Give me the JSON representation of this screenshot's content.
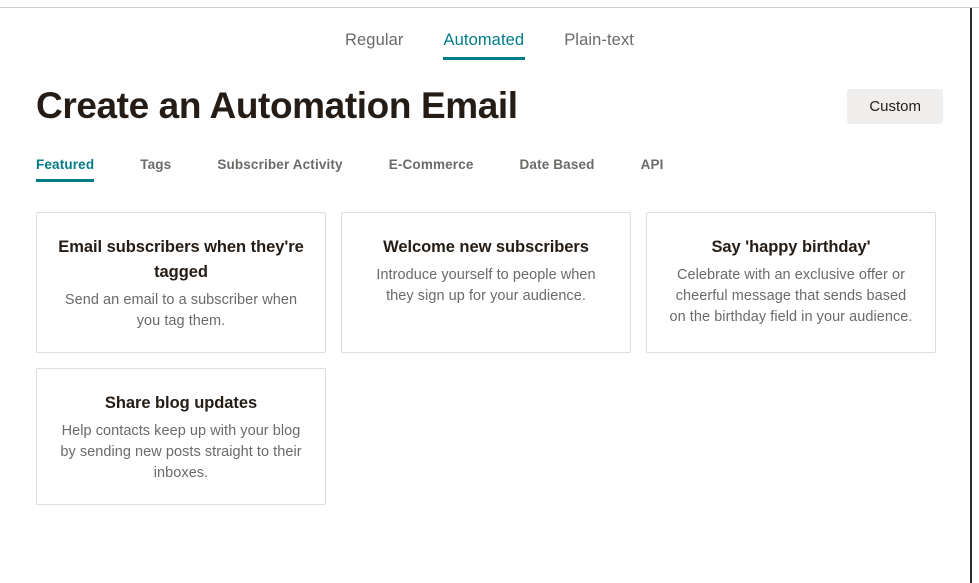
{
  "window": {
    "accent_color": "#007c89",
    "text_color": "#241c15",
    "muted_text_color": "#6c6a67",
    "card_border_color": "#dedddb",
    "button_bg_color": "#efeeec"
  },
  "primary_tabs": [
    {
      "label": "Regular",
      "active": false
    },
    {
      "label": "Automated",
      "active": true
    },
    {
      "label": "Plain-text",
      "active": false
    }
  ],
  "header": {
    "title": "Create an Automation Email",
    "custom_button_label": "Custom"
  },
  "secondary_tabs": [
    {
      "label": "Featured",
      "active": true
    },
    {
      "label": "Tags",
      "active": false
    },
    {
      "label": "Subscriber Activity",
      "active": false
    },
    {
      "label": "E-Commerce",
      "active": false
    },
    {
      "label": "Date Based",
      "active": false
    },
    {
      "label": "API",
      "active": false
    }
  ],
  "cards": [
    {
      "title": "Email subscribers when they're tagged",
      "description": "Send an email to a subscriber when you tag them."
    },
    {
      "title": "Welcome new subscribers",
      "description": "Introduce yourself to people when they sign up for your audience."
    },
    {
      "title": "Say 'happy birthday'",
      "description": "Celebrate with an exclusive offer or cheerful message that sends based on the birthday field in your audience."
    },
    {
      "title": "Share blog updates",
      "description": "Help contacts keep up with your blog by sending new posts straight to their inboxes."
    }
  ]
}
